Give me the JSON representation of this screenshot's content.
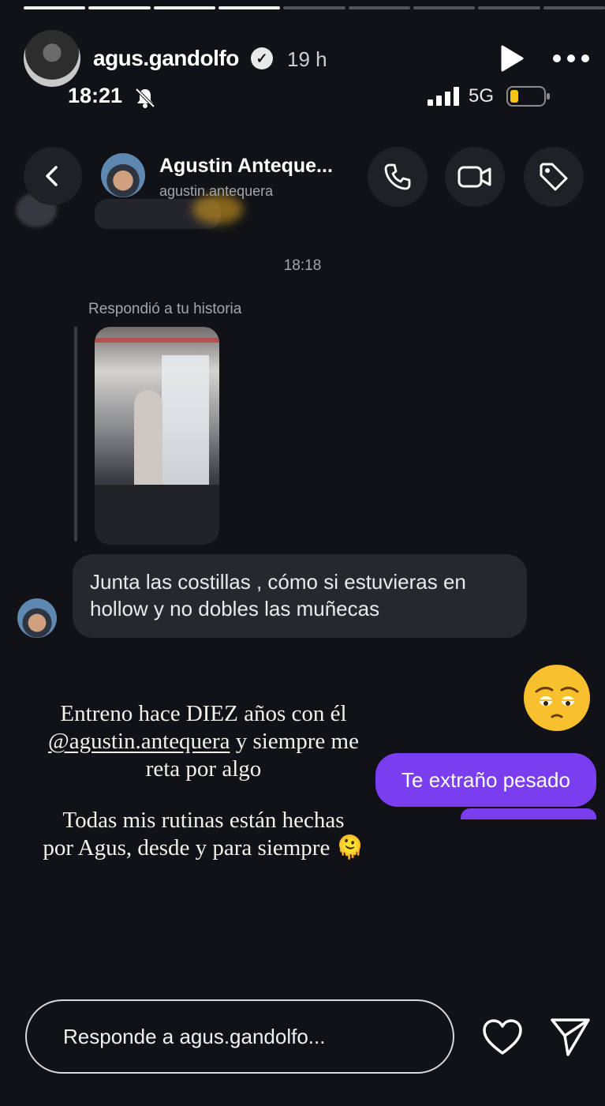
{
  "story": {
    "progress_total": 9,
    "progress_done": 4,
    "username": "agus.gandolfo",
    "verified_icon": "verified-badge-icon",
    "time_ago": "19 h",
    "caption": {
      "line1": "Entreno hace DIEZ años con él",
      "mention": "@agustin.antequera",
      "line2_rest": " y siempre me",
      "line3": "reta por algo",
      "line4": "Todas mis rutinas están hechas",
      "line5": "por Agus, desde y para siempre 🫠"
    },
    "reply_placeholder": "Responde a agus.gandolfo..."
  },
  "status_bar": {
    "clock": "18:21",
    "network": "5G",
    "battery_color": "#f5c518"
  },
  "chat": {
    "name": "Agustin Anteque...",
    "handle": "agustin.antequera",
    "timestamp": "18:18",
    "replied_label": "Respondió a tu historia",
    "incoming_message_line1": "Junta las costillas , cómo si estuvieras en",
    "incoming_message_line2": "hollow y no dobles las muñecas",
    "reaction_emoji": "pleading-face-emoji",
    "outgoing_message": "Te extraño pesado"
  },
  "colors": {
    "accent_purple": "#7b3df0",
    "bubble_gray": "#26282e",
    "background": "#111217"
  }
}
